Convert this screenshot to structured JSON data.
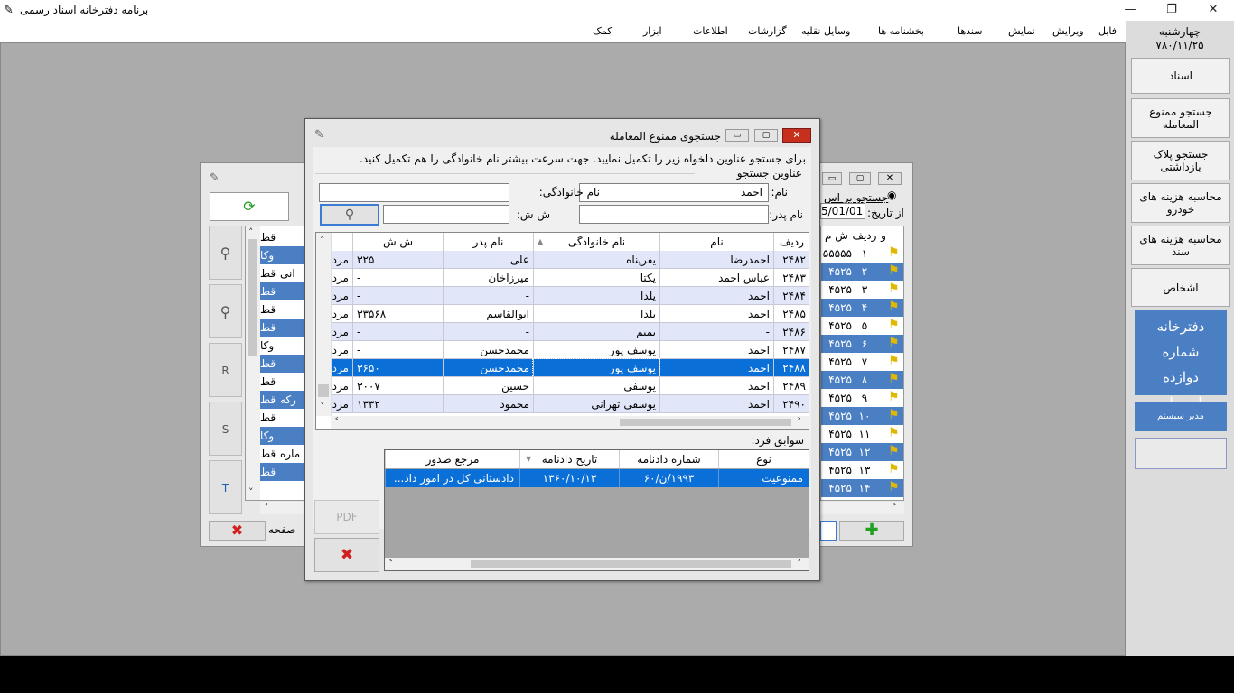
{
  "app": {
    "title": "برنامه دفترخانه اسناد رسمی",
    "win_minimize": "—",
    "win_restore": "❐",
    "win_close": "✕"
  },
  "menu": [
    "فایل",
    "ویرایش",
    "نمایش",
    "سندها",
    "بخشنامه ها",
    "وسایل نقلیه",
    "گزارشات",
    "اطلاعات",
    "ابزار",
    "کمک"
  ],
  "sidebar": {
    "day": "چهارشنبه",
    "date": "۷۸۰/۱۱/۲۵",
    "buttons": [
      "اسناد",
      "جستجو ممنوع المعامله",
      "جستجو پلاک بازداشتی",
      "محاسبه هزینه های خودرو",
      "محاسبه هزینه های سند",
      "اشخاص"
    ],
    "office": "دفترخانه شماره دوازده اصفهان",
    "admin": "مدیر سیستم"
  },
  "bg_window": {
    "search_by": "جستجو بر اس",
    "from_date_label": "از تاریخ:",
    "from_date_value": "5/01/01",
    "col_v": "و",
    "col_row": "ردیف",
    "col_sm": "ش م",
    "rows": [
      {
        "n": "۱",
        "v": "۵۵۵۵۵"
      },
      {
        "n": "۲",
        "v": "۴۵۲۵"
      },
      {
        "n": "۳",
        "v": "۴۵۲۵"
      },
      {
        "n": "۴",
        "v": "۴۵۲۵"
      },
      {
        "n": "۵",
        "v": "۴۵۲۵"
      },
      {
        "n": "۶",
        "v": "۴۵۲۵"
      },
      {
        "n": "۷",
        "v": "۴۵۲۵"
      },
      {
        "n": "۸",
        "v": "۴۵۲۵"
      },
      {
        "n": "۹",
        "v": "۴۵۲۵"
      },
      {
        "n": "۱۰",
        "v": "۴۵۲۵"
      },
      {
        "n": "۱۱",
        "v": "۴۵۲۵"
      },
      {
        "n": "۱۲",
        "v": "۴۵۲۵"
      },
      {
        "n": "۱۳",
        "v": "۴۵۲۵"
      },
      {
        "n": "۱۴",
        "v": "۴۵۲۵"
      }
    ],
    "left_cells": [
      "قط",
      "وکا",
      "قط",
      "قط",
      "قط",
      "قط",
      "وکا",
      "قط",
      "قط",
      "قط",
      "قط",
      "وکا",
      "قط",
      "قط"
    ],
    "left_cells2": [
      "",
      "",
      "انی",
      "",
      "",
      "",
      "",
      "",
      "",
      "رکه",
      "",
      "",
      "ماره",
      ""
    ],
    "tools": [
      "R",
      "S",
      "T"
    ],
    "page_label": "صفحه"
  },
  "dialog": {
    "title": "جستجوی ممنوع المعامله",
    "hint": "برای جستجو عناوین دلخواه زیر را تکمیل نمایید. جهت سرعت بیشتر نام خانوادگی را هم تکمیل کنید.",
    "group_title": "عناوین جستجو",
    "name_label": "نام:",
    "name_value": "احمد",
    "family_label": "نام خانوادگی:",
    "family_value": "",
    "father_label": "نام پدر:",
    "father_value": "",
    "ss_label": "ش ش:",
    "ss_value": "",
    "grid": {
      "headers": [
        "ردیف",
        "نام",
        "نام خانوادگی",
        "نام پدر",
        "ش ش",
        ""
      ],
      "rows": [
        [
          "۲۴۸۲",
          "احمدرضا",
          "یفرپناه",
          "علی",
          "۳۲۵",
          "مرد"
        ],
        [
          "۲۴۸۳",
          "عباس احمد",
          "یکتا",
          "میرزاخان",
          "-",
          "مرد"
        ],
        [
          "۲۴۸۴",
          "احمد",
          "یلدا",
          "-",
          "-",
          "مرد"
        ],
        [
          "۲۴۸۵",
          "احمد",
          "یلدا",
          "ابوالقاسم",
          "۳۳۵۶۸",
          "مرد"
        ],
        [
          "۲۴۸۶",
          "-",
          "یمیم",
          "-",
          "-",
          "مرد"
        ],
        [
          "۲۴۸۷",
          "احمد",
          "یوسف پور",
          "محمدحسن",
          "-",
          "مرد"
        ],
        [
          "۲۴۸۸",
          "احمد",
          "یوسف پور",
          "محمدحسن",
          "۳۶۵۰",
          "مرد"
        ],
        [
          "۲۴۸۹",
          "احمد",
          "یوسفی",
          "حسین",
          "۳۰۰۷",
          "مرد"
        ],
        [
          "۲۴۹۰",
          "احمد",
          "یوسفی تهرانی",
          "محمود",
          "۱۳۳۲",
          "مرد"
        ]
      ],
      "selected_row": 6
    },
    "history_label": "سوابق فرد:",
    "history": {
      "headers": [
        "نوع",
        "شماره دادنامه",
        "تاریخ دادنامه",
        "مرجع صدور"
      ],
      "row": [
        "ممنوعیت",
        "۱۹۹۳/ن/۶۰",
        "۱۳۶۰/۱۰/۱۳",
        "دادستانی کل در امور داد..."
      ]
    },
    "pdf_label": "PDF"
  }
}
